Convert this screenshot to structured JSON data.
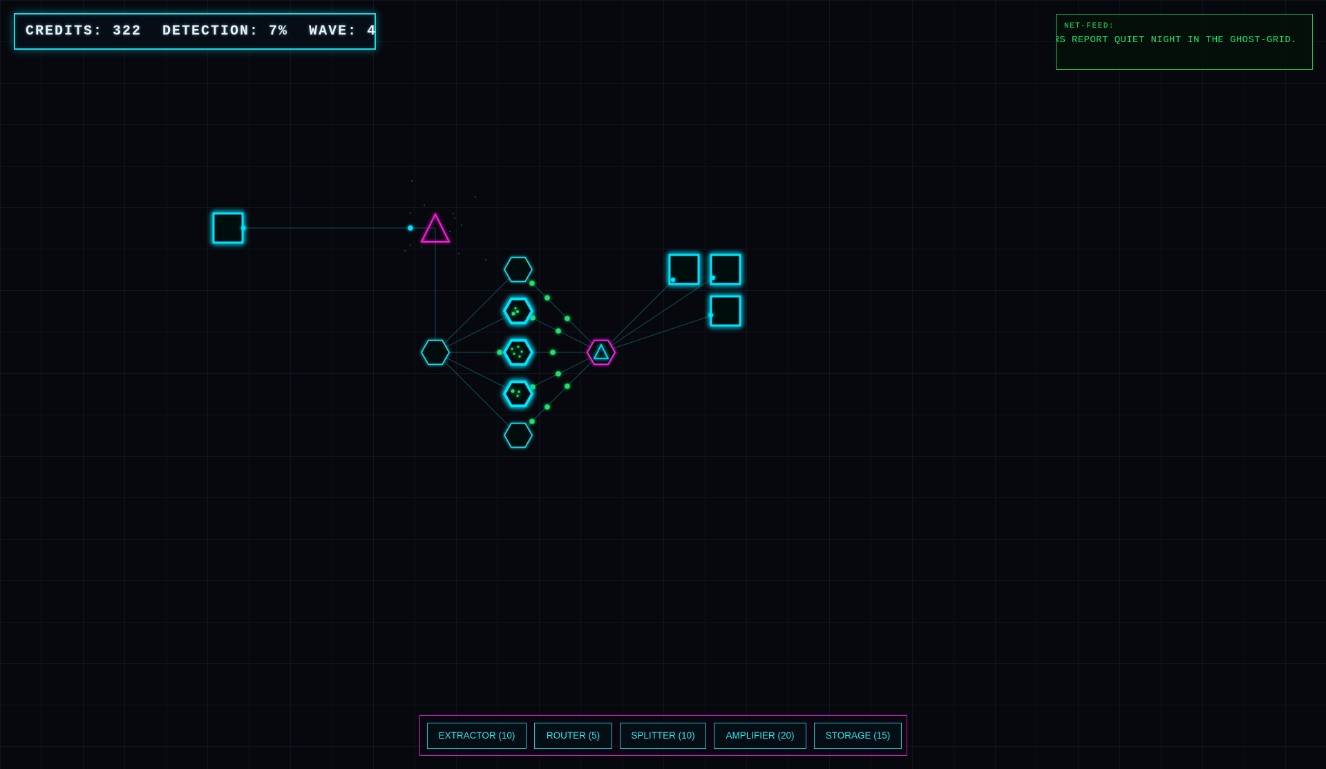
{
  "hud": {
    "credits": "CREDITS: 322",
    "detection": "DETECTION: 7%",
    "wave": "WAVE: 4"
  },
  "net_feed": {
    "title": "NET-FEED:",
    "message": "RS REPORT QUIET NIGHT IN THE GHOST-GRID."
  },
  "build_menu": {
    "buttons": [
      {
        "id": "extractor",
        "label": "EXTRACTOR (10)"
      },
      {
        "id": "router",
        "label": "ROUTER (5)"
      },
      {
        "id": "splitter",
        "label": "SPLITTER (10)"
      },
      {
        "id": "amplifier",
        "label": "AMPLIFIER (20)"
      },
      {
        "id": "storage",
        "label": "STORAGE (15)"
      }
    ]
  },
  "colors": {
    "cyan": "#00e5ff",
    "magenta": "#ff1ee0",
    "green": "#1fe36a",
    "hud_border": "#1fd8e6",
    "feed_border": "#19c45a",
    "menu_border": "#c81ec8"
  },
  "network": {
    "nodes": [
      {
        "id": "storage-a",
        "kind": "storage-node",
        "role": "storage"
      },
      {
        "id": "extractor-top",
        "kind": "extractor-node",
        "role": "extractor"
      },
      {
        "id": "router-left",
        "kind": "router-node",
        "role": "router"
      },
      {
        "id": "router-1",
        "kind": "router-node",
        "role": "router"
      },
      {
        "id": "amp-2",
        "kind": "amplifier-node",
        "role": "amplifier"
      },
      {
        "id": "amp-3",
        "kind": "amplifier-node",
        "role": "amplifier"
      },
      {
        "id": "amp-4",
        "kind": "amplifier-node",
        "role": "amplifier"
      },
      {
        "id": "router-5",
        "kind": "router-node",
        "role": "router"
      },
      {
        "id": "core",
        "kind": "core-node",
        "role": "core"
      },
      {
        "id": "storage-b",
        "kind": "storage-node",
        "role": "storage"
      },
      {
        "id": "storage-c",
        "kind": "storage-node",
        "role": "storage"
      },
      {
        "id": "storage-d",
        "kind": "storage-node",
        "role": "storage"
      }
    ],
    "links": [
      [
        "storage-a",
        "extractor-top"
      ],
      [
        "extractor-top",
        "router-left"
      ],
      [
        "router-left",
        "router-1"
      ],
      [
        "router-left",
        "amp-2"
      ],
      [
        "router-left",
        "amp-3"
      ],
      [
        "router-left",
        "amp-4"
      ],
      [
        "router-left",
        "router-5"
      ],
      [
        "router-1",
        "core"
      ],
      [
        "amp-2",
        "core"
      ],
      [
        "amp-3",
        "core"
      ],
      [
        "amp-4",
        "core"
      ],
      [
        "router-5",
        "core"
      ],
      [
        "core",
        "storage-b"
      ],
      [
        "core",
        "storage-c"
      ],
      [
        "core",
        "storage-d"
      ]
    ]
  }
}
